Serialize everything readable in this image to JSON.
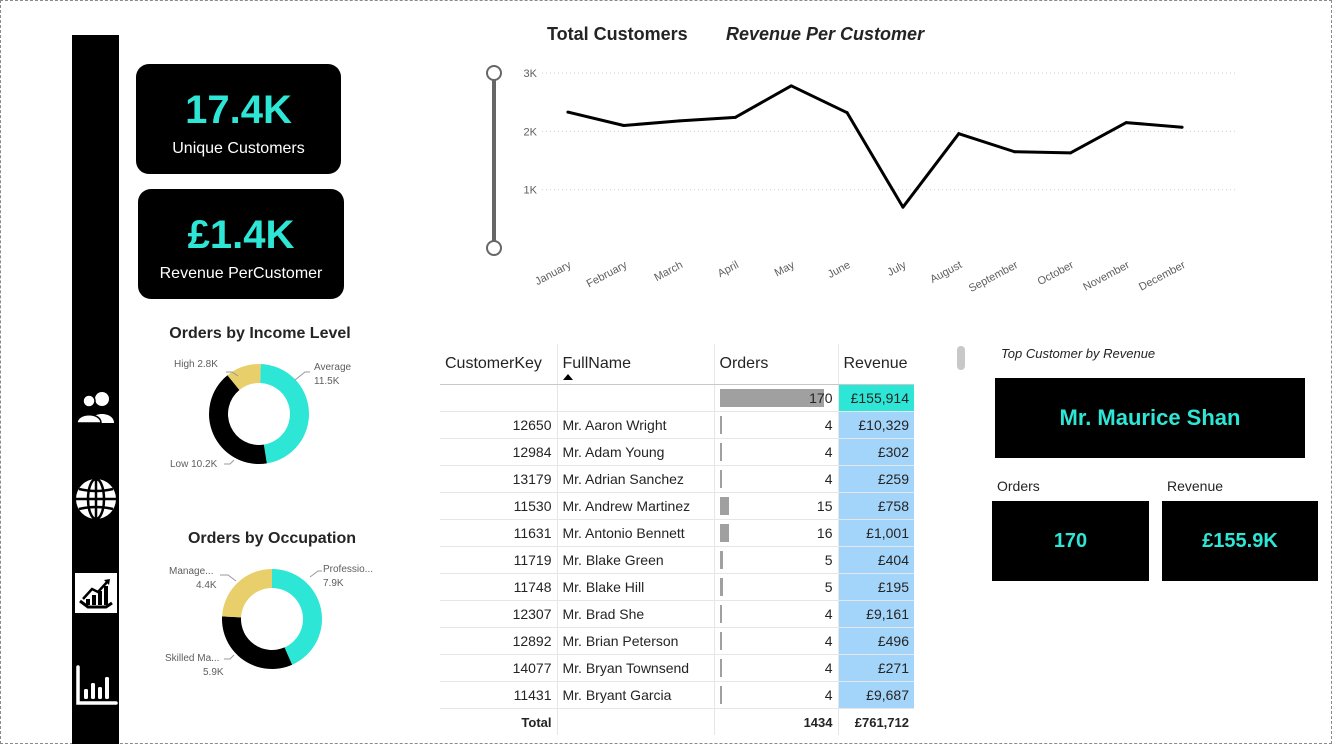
{
  "nav": {
    "icons": [
      "users-icon",
      "globe-icon",
      "growth-chart-icon",
      "bar-chart-icon"
    ]
  },
  "kpis": {
    "unique_customers": {
      "value": "17.4K",
      "label": "Unique Customers"
    },
    "revenue_per_customer": {
      "value": "£1.4K",
      "label": "Revenue PerCustomer"
    }
  },
  "donut_income": {
    "title": "Orders by Income Level",
    "labels": {
      "high": "High 2.8K",
      "average": "Average",
      "average_val": "11.5K",
      "low": "Low 10.2K"
    },
    "values": [
      {
        "name": "Average",
        "value": 11.5
      },
      {
        "name": "Low",
        "value": 10.2
      },
      {
        "name": "High",
        "value": 2.8
      }
    ]
  },
  "donut_occupation": {
    "title": "Orders by Occupation",
    "labels": {
      "prof": "Professio...",
      "prof_val": "7.9K",
      "mgmt": "Manage...",
      "mgmt_val": "4.4K",
      "skilled": "Skilled Ma...",
      "skilled_val": "5.9K"
    },
    "values": [
      {
        "name": "Professio...",
        "value": 7.9
      },
      {
        "name": "Skilled Ma...",
        "value": 5.9
      },
      {
        "name": "Manage...",
        "value": 4.4
      }
    ]
  },
  "line_chart": {
    "buttons": {
      "total_customers": "Total Customers",
      "revenue_per_customer": "Revenue Per Customer"
    }
  },
  "chart_data": {
    "type": "line",
    "categories": [
      "January",
      "February",
      "March",
      "April",
      "May",
      "June",
      "July",
      "August",
      "September",
      "October",
      "November",
      "December"
    ],
    "values": [
      2330,
      2100,
      2180,
      2240,
      2780,
      2320,
      700,
      1960,
      1650,
      1630,
      2150,
      2070
    ],
    "ylim": [
      0,
      3000
    ],
    "yticks": [
      "1K",
      "2K",
      "3K"
    ],
    "grid": true,
    "color": "#000000"
  },
  "table": {
    "headers": [
      "CustomerKey",
      "FullName",
      "Orders",
      "Revenue"
    ],
    "summary": {
      "orders": "170",
      "orders_frac": 1.0,
      "revenue": "£155,914"
    },
    "rows": [
      {
        "key": "12650",
        "name": "Mr. Aaron Wright",
        "orders": "4",
        "revenue": "£10,329"
      },
      {
        "key": "12984",
        "name": "Mr. Adam Young",
        "orders": "4",
        "revenue": "£302"
      },
      {
        "key": "13179",
        "name": "Mr. Adrian Sanchez",
        "orders": "4",
        "revenue": "£259"
      },
      {
        "key": "11530",
        "name": "Mr. Andrew Martinez",
        "orders": "15",
        "revenue": "£758"
      },
      {
        "key": "11631",
        "name": "Mr. Antonio Bennett",
        "orders": "16",
        "revenue": "£1,001"
      },
      {
        "key": "11719",
        "name": "Mr. Blake Green",
        "orders": "5",
        "revenue": "£404"
      },
      {
        "key": "11748",
        "name": "Mr. Blake Hill",
        "orders": "5",
        "revenue": "£195"
      },
      {
        "key": "12307",
        "name": "Mr. Brad She",
        "orders": "4",
        "revenue": "£9,161"
      },
      {
        "key": "12892",
        "name": "Mr. Brian Peterson",
        "orders": "4",
        "revenue": "£496"
      },
      {
        "key": "14077",
        "name": "Mr. Bryan Townsend",
        "orders": "4",
        "revenue": "£271"
      },
      {
        "key": "11431",
        "name": "Mr. Bryant Garcia",
        "orders": "4",
        "revenue": "£9,687"
      }
    ],
    "total": {
      "label": "Total",
      "orders": "1434",
      "revenue": "£761,712"
    }
  },
  "top_customer": {
    "title": "Top Customer by Revenue",
    "name": "Mr. Maurice Shan",
    "orders_label": "Orders",
    "orders_value": "170",
    "revenue_label": "Revenue",
    "revenue_value": "£155.9K"
  },
  "colors": {
    "accent": "#2ee6d6",
    "revenue_cell": "#a3d4fa",
    "donut_yellow": "#e8cf6c",
    "donut_black": "#000000"
  }
}
